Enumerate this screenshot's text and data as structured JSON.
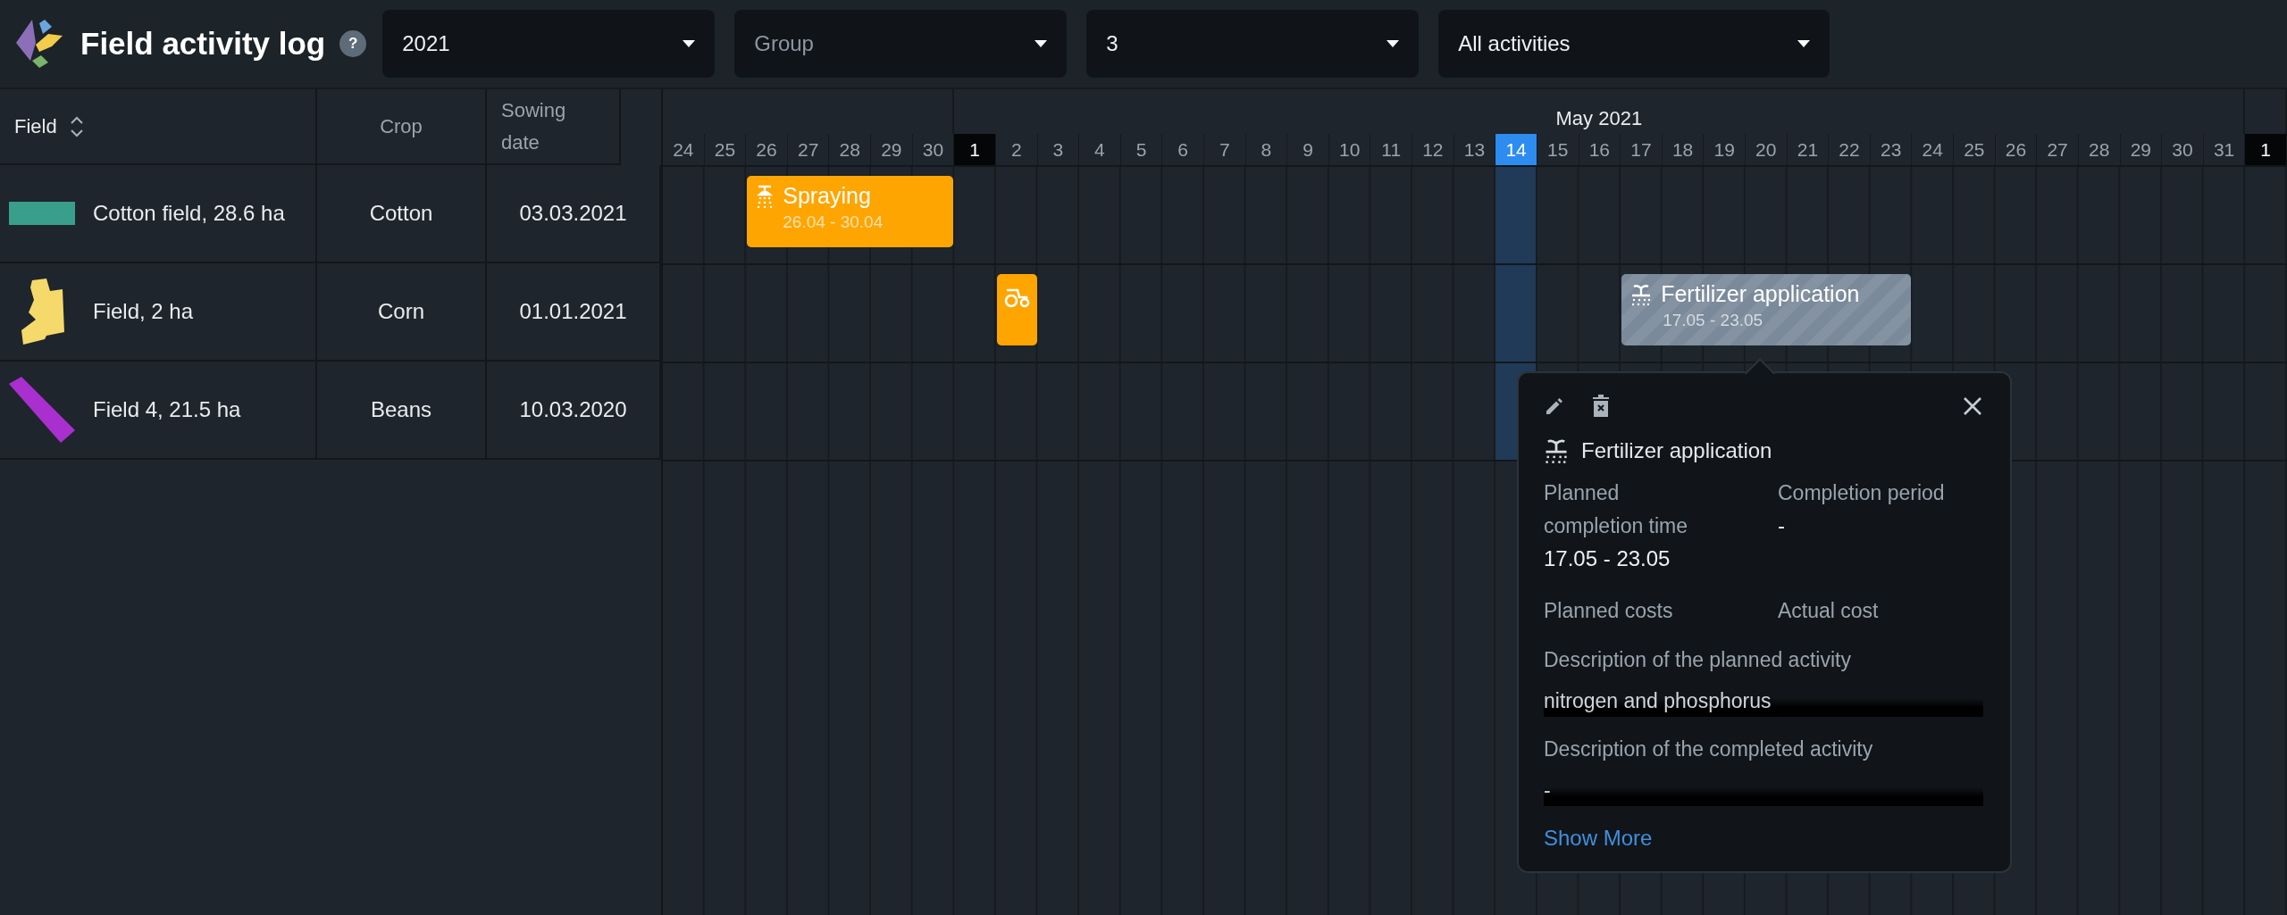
{
  "header": {
    "title": "Field activity log",
    "help": "?"
  },
  "filters": [
    {
      "value": "2021"
    },
    {
      "placeholder": "Group"
    },
    {
      "value": "3"
    },
    {
      "value": "All activities"
    }
  ],
  "table": {
    "columns": [
      "Field",
      "Crop",
      "Sowing date"
    ],
    "rows": [
      {
        "field": "Cotton field, 28.6 ha",
        "shape": {
          "kind": "rectangle",
          "color": "#3a9e8c"
        },
        "crop": "Cotton",
        "sowing_date": "03.03.2021",
        "slots": [
          {
            "kind": "empty"
          },
          {
            "kind": "empty"
          },
          {
            "kind": "spraying",
            "title": "Spraying",
            "period": "26.04 - 30.04",
            "selected": false
          },
          {
            "kind": "continued"
          },
          {
            "kind": "continued"
          },
          {
            "kind": "continued"
          },
          {
            "kind": "continued"
          },
          {
            "kind": "empty"
          },
          {
            "kind": "empty"
          },
          {
            "kind": "empty"
          },
          {
            "kind": "empty"
          },
          {
            "kind": "empty"
          },
          {
            "kind": "empty"
          },
          {
            "kind": "empty"
          },
          {
            "kind": "empty"
          },
          {
            "kind": "empty"
          },
          {
            "kind": "empty"
          },
          {
            "kind": "empty"
          },
          {
            "kind": "empty"
          },
          {
            "kind": "empty"
          },
          {
            "kind": "empty"
          },
          {
            "kind": "empty"
          },
          {
            "kind": "empty"
          },
          {
            "kind": "empty"
          },
          {
            "kind": "empty"
          },
          {
            "kind": "empty"
          },
          {
            "kind": "empty"
          },
          {
            "kind": "empty"
          },
          {
            "kind": "empty"
          },
          {
            "kind": "empty"
          },
          {
            "kind": "empty"
          },
          {
            "kind": "empty"
          },
          {
            "kind": "empty"
          },
          {
            "kind": "empty"
          },
          {
            "kind": "empty"
          },
          {
            "kind": "empty"
          },
          {
            "kind": "empty"
          },
          {
            "kind": "empty"
          },
          {
            "kind": "empty"
          }
        ]
      },
      {
        "field": "Field, 2 ha",
        "shape": {
          "kind": "polygon",
          "color": "#f5d96b"
        },
        "crop": "Corn",
        "sowing_date": "01.01.2021",
        "slots": [
          {
            "kind": "empty"
          },
          {
            "kind": "empty"
          },
          {
            "kind": "empty"
          },
          {
            "kind": "empty"
          },
          {
            "kind": "empty"
          },
          {
            "kind": "empty"
          },
          {
            "kind": "empty"
          },
          {
            "kind": "empty"
          },
          {
            "kind": "tractor",
            "selected": false
          },
          {
            "kind": "empty"
          },
          {
            "kind": "empty"
          },
          {
            "kind": "empty"
          },
          {
            "kind": "empty"
          },
          {
            "kind": "empty"
          },
          {
            "kind": "empty"
          },
          {
            "kind": "empty"
          },
          {
            "kind": "empty"
          },
          {
            "kind": "empty"
          },
          {
            "kind": "empty"
          },
          {
            "kind": "empty"
          },
          {
            "kind": "empty"
          },
          {
            "kind": "empty"
          },
          {
            "kind": "empty"
          },
          {
            "kind": "fertilizer",
            "title": "Fertilizer application",
            "period": "17.05 - 23.05",
            "selected": true
          },
          {
            "kind": "continued"
          },
          {
            "kind": "continued"
          },
          {
            "kind": "continued"
          },
          {
            "kind": "continued"
          },
          {
            "kind": "continued"
          },
          {
            "kind": "continued"
          },
          {
            "kind": "empty"
          },
          {
            "kind": "empty"
          },
          {
            "kind": "empty"
          },
          {
            "kind": "empty"
          },
          {
            "kind": "empty"
          },
          {
            "kind": "empty"
          },
          {
            "kind": "empty"
          },
          {
            "kind": "empty"
          },
          {
            "kind": "empty"
          }
        ]
      },
      {
        "field": "Field 4, 21.5 ha",
        "shape": {
          "kind": "strip",
          "color": "#a92fcf"
        },
        "crop": "Beans",
        "sowing_date": "10.03.2020",
        "slots": [
          {
            "kind": "empty"
          },
          {
            "kind": "empty"
          },
          {
            "kind": "empty"
          },
          {
            "kind": "empty"
          },
          {
            "kind": "empty"
          },
          {
            "kind": "empty"
          },
          {
            "kind": "empty"
          },
          {
            "kind": "empty"
          },
          {
            "kind": "empty"
          },
          {
            "kind": "empty"
          },
          {
            "kind": "empty"
          },
          {
            "kind": "empty"
          },
          {
            "kind": "empty"
          },
          {
            "kind": "empty"
          },
          {
            "kind": "empty"
          },
          {
            "kind": "empty"
          },
          {
            "kind": "empty"
          },
          {
            "kind": "empty"
          },
          {
            "kind": "empty"
          },
          {
            "kind": "empty"
          },
          {
            "kind": "empty"
          },
          {
            "kind": "empty"
          },
          {
            "kind": "empty"
          },
          {
            "kind": "empty"
          },
          {
            "kind": "empty"
          },
          {
            "kind": "empty"
          },
          {
            "kind": "empty"
          },
          {
            "kind": "empty"
          },
          {
            "kind": "empty"
          },
          {
            "kind": "empty"
          },
          {
            "kind": "empty"
          },
          {
            "kind": "empty"
          },
          {
            "kind": "empty"
          },
          {
            "kind": "empty"
          },
          {
            "kind": "empty"
          },
          {
            "kind": "empty"
          },
          {
            "kind": "empty"
          },
          {
            "kind": "empty"
          },
          {
            "kind": "empty"
          }
        ]
      }
    ]
  },
  "timeline": {
    "months": [
      {
        "days": [
          {
            "label": "24",
            "today": false
          },
          {
            "label": "25",
            "today": false
          },
          {
            "label": "26",
            "today": false
          },
          {
            "label": "27",
            "today": false
          },
          {
            "label": "28",
            "today": false
          },
          {
            "label": "29",
            "today": false
          },
          {
            "label": "30",
            "today": false
          }
        ]
      },
      {
        "label": "May 2021",
        "days": [
          {
            "label": "1",
            "today": false
          },
          {
            "label": "2",
            "today": false
          },
          {
            "label": "3",
            "today": false
          },
          {
            "label": "4",
            "today": false
          },
          {
            "label": "5",
            "today": false
          },
          {
            "label": "6",
            "today": false
          },
          {
            "label": "7",
            "today": false
          },
          {
            "label": "8",
            "today": false
          },
          {
            "label": "9",
            "today": false
          },
          {
            "label": "10",
            "today": false
          },
          {
            "label": "11",
            "today": false
          },
          {
            "label": "12",
            "today": false
          },
          {
            "label": "13",
            "today": false
          },
          {
            "label": "14",
            "today": true
          },
          {
            "label": "15",
            "today": false
          },
          {
            "label": "16",
            "today": false
          },
          {
            "label": "17",
            "today": false
          },
          {
            "label": "18",
            "today": false
          },
          {
            "label": "19",
            "today": false
          },
          {
            "label": "20",
            "today": false
          },
          {
            "label": "21",
            "today": false
          },
          {
            "label": "22",
            "today": false
          },
          {
            "label": "23",
            "today": false
          },
          {
            "label": "24",
            "today": false
          },
          {
            "label": "25",
            "today": false
          },
          {
            "label": "26",
            "today": false
          },
          {
            "label": "27",
            "today": false
          },
          {
            "label": "28",
            "today": false
          },
          {
            "label": "29",
            "today": false
          },
          {
            "label": "30",
            "today": false
          },
          {
            "label": "31",
            "today": false
          }
        ]
      },
      {
        "days": [
          {
            "label": "1",
            "today": false
          }
        ]
      }
    ]
  },
  "popup": {
    "title": "Fertilizer application",
    "details": [
      {
        "label": "Planned completion time",
        "value": "17.05 - 23.05"
      },
      {
        "label": "Completion period",
        "value": "-"
      },
      {
        "label": "Planned costs"
      },
      {
        "label": "Actual cost"
      }
    ],
    "descriptions": [
      {
        "label": "Description of the planned activity",
        "value": "nitrogen and phosphorus"
      },
      {
        "label": "Description of the completed activity",
        "value": "-"
      }
    ],
    "link": "Show More"
  }
}
